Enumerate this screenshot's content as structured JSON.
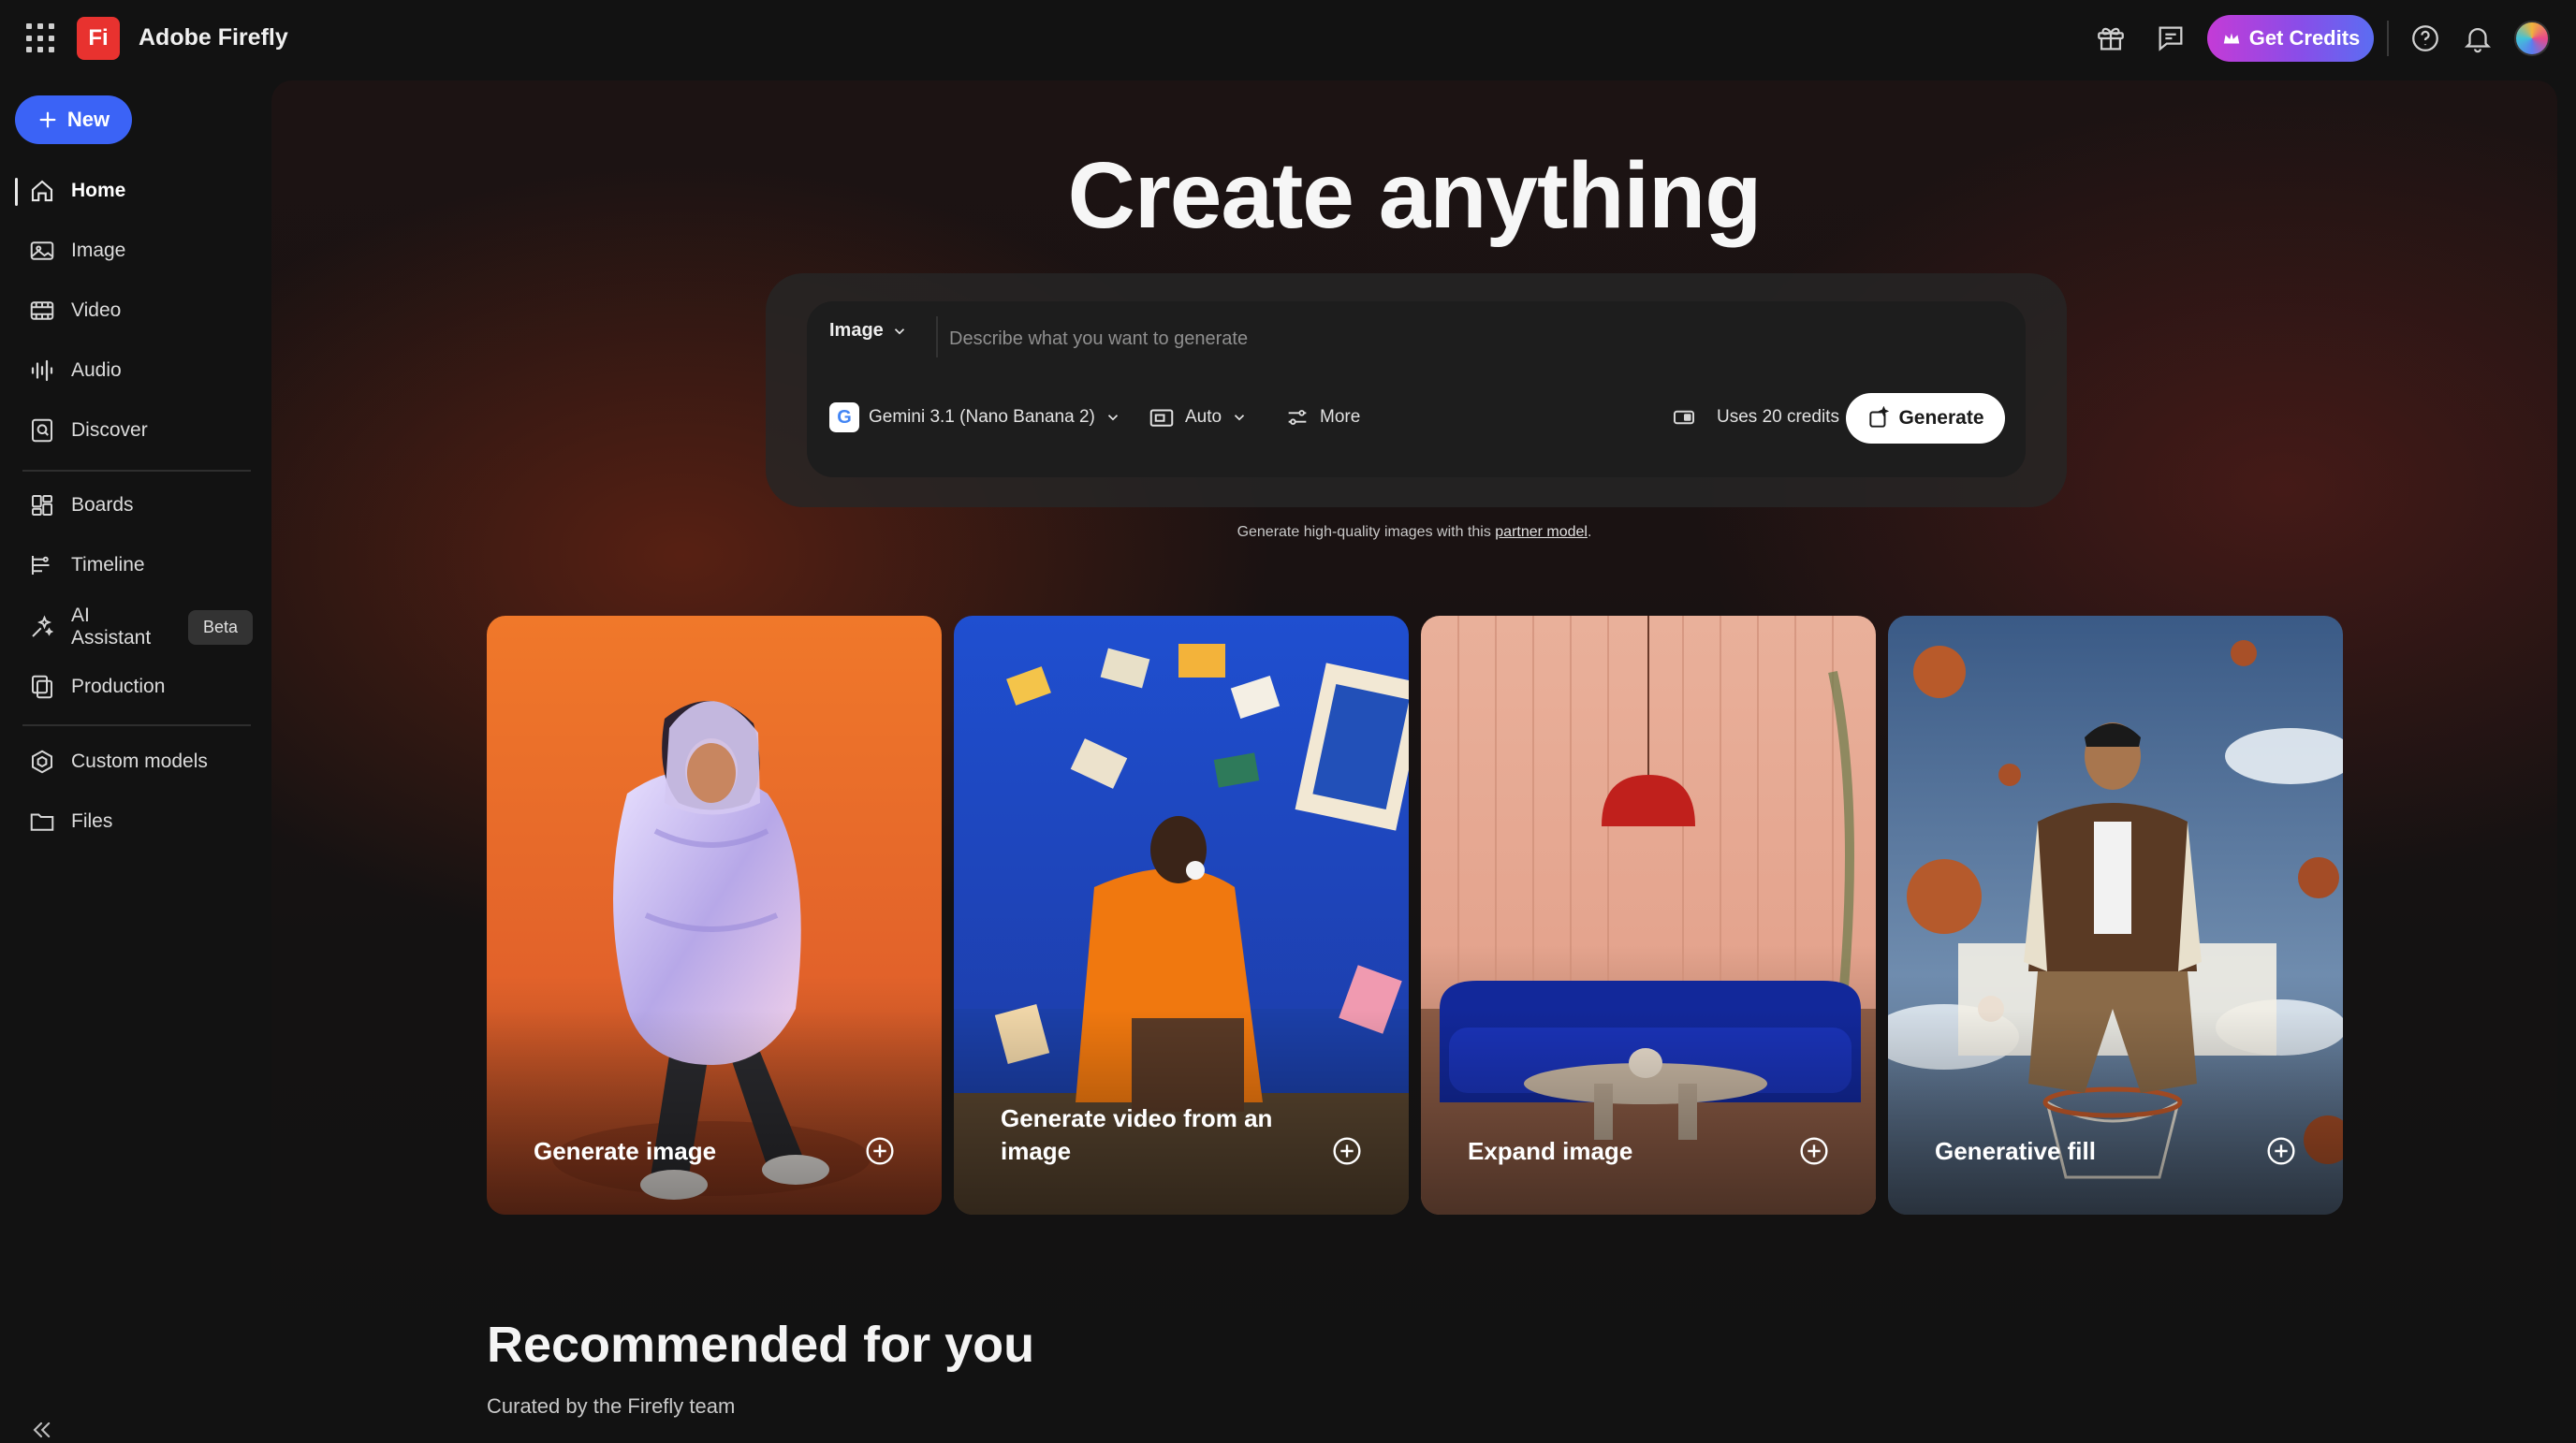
{
  "app": {
    "title": "Adobe Firefly",
    "logo_text": "Fi"
  },
  "topbar": {
    "get_credits_label": "Get Credits"
  },
  "sidebar": {
    "new_label": "New",
    "items": [
      {
        "label": "Home",
        "icon": "home-icon"
      },
      {
        "label": "Image",
        "icon": "image-icon"
      },
      {
        "label": "Video",
        "icon": "video-icon"
      },
      {
        "label": "Audio",
        "icon": "audio-icon"
      },
      {
        "label": "Discover",
        "icon": "discover-icon"
      },
      {
        "label": "Boards",
        "icon": "boards-icon"
      },
      {
        "label": "Timeline",
        "icon": "timeline-icon"
      },
      {
        "label": "AI Assistant",
        "icon": "ai-assistant-icon",
        "badge": "Beta"
      },
      {
        "label": "Production",
        "icon": "production-icon"
      },
      {
        "label": "Custom models",
        "icon": "custom-models-icon"
      },
      {
        "label": "Files",
        "icon": "folder-icon"
      }
    ]
  },
  "hero": {
    "title": "Create anything"
  },
  "prompt": {
    "type_label": "Image",
    "placeholder": "Describe what you want to generate",
    "value": "",
    "model_label": "Gemini 3.1 (Nano Banana 2)",
    "aspect_label": "Auto",
    "more_label": "More",
    "credits_label": "Uses 20 credits",
    "generate_label": "Generate",
    "note_prefix": "Generate high-quality images with this",
    "note_link": "partner model",
    "note_suffix": "."
  },
  "cards": [
    {
      "label": "Generate image"
    },
    {
      "label": "Generate video from an image"
    },
    {
      "label": "Expand image"
    },
    {
      "label": "Generative fill"
    }
  ],
  "recommended": {
    "title": "Recommended for you",
    "subtitle": "Curated by the Firefly team"
  },
  "colors": {
    "accent_blue": "#3b63f6",
    "brand_red": "#e8322f",
    "credits_gradient_start": "#c43bd6",
    "credits_gradient_end": "#5b6df2"
  }
}
